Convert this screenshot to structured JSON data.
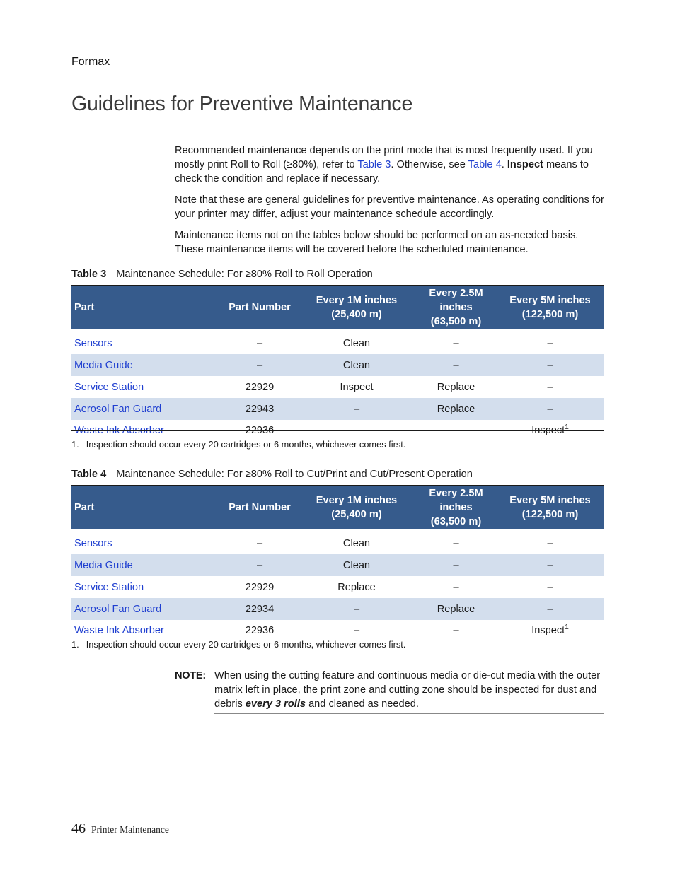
{
  "running_head": "Formax",
  "page_title": "Guidelines for Preventive Maintenance",
  "intro": {
    "p1_a": "Recommended maintenance depends on the print mode that is most frequently used. If you mostly print Roll to Roll (≥80%), refer to ",
    "p1_link1": "Table 3",
    "p1_b": ". Otherwise, see ",
    "p1_link2": "Table 4",
    "p1_c": ". ",
    "p1_bold": "Inspect",
    "p1_d": " means to check the condition and replace if necessary.",
    "p2": "Note that these are general guidelines for preventive maintenance. As operating conditions for your printer may differ, adjust your maintenance schedule accordingly.",
    "p3": "Maintenance items not on the tables below should be performed on an as-needed basis. These maintenance items will be covered before the scheduled maintenance."
  },
  "tables": [
    {
      "label": "Table 3",
      "title": "Maintenance Schedule: For ≥80% Roll to Roll Operation",
      "headers": [
        "Part",
        "Part Number",
        "Every 1M inches",
        "(25,400 m)",
        "Every 2.5M inches",
        "(63,500 m)",
        "Every 5M inches",
        "(122,500 m)"
      ],
      "rows": [
        {
          "part": "Sensors",
          "number": "–",
          "c1": "Clean",
          "c2": "–",
          "c3": "–"
        },
        {
          "part": "Media Guide",
          "number": "–",
          "c1": "Clean",
          "c2": "–",
          "c3": "–"
        },
        {
          "part": "Service Station",
          "number": "22929",
          "c1": "Inspect",
          "c2": "Replace",
          "c3": "–"
        },
        {
          "part": "Aerosol Fan Guard",
          "number": "22943",
          "c1": "–",
          "c2": "Replace",
          "c3": "–"
        },
        {
          "part": "Waste Ink Absorber",
          "number": "22936",
          "c1": "–",
          "c2": "–",
          "c3": "Inspect",
          "c3_sup": "1"
        }
      ],
      "footnote_num": "1.",
      "footnote": "Inspection should occur every 20 cartridges or 6 months, whichever comes first."
    },
    {
      "label": "Table 4",
      "title": "Maintenance Schedule: For ≥80% Roll to Cut/Print and Cut/Present Operation",
      "headers": [
        "Part",
        "Part Number",
        "Every 1M inches",
        "(25,400 m)",
        "Every 2.5M inches",
        "(63,500 m)",
        "Every 5M inches",
        "(122,500 m)"
      ],
      "rows": [
        {
          "part": "Sensors",
          "number": "–",
          "c1": "Clean",
          "c2": "–",
          "c3": "–"
        },
        {
          "part": "Media Guide",
          "number": "–",
          "c1": "Clean",
          "c2": "–",
          "c3": "–"
        },
        {
          "part": "Service Station",
          "number": "22929",
          "c1": "Replace",
          "c2": "–",
          "c3": "–"
        },
        {
          "part": "Aerosol Fan Guard",
          "number": "22934",
          "c1": "–",
          "c2": "Replace",
          "c3": "–"
        },
        {
          "part": "Waste Ink Absorber",
          "number": "22936",
          "c1": "–",
          "c2": "–",
          "c3": "Inspect",
          "c3_sup": "1"
        }
      ],
      "footnote_num": "1.",
      "footnote": "Inspection should occur every 20 cartridges or 6 months, whichever comes first."
    }
  ],
  "note": {
    "label": "NOTE:",
    "text_a": "When using the cutting feature and continuous media or die-cut media with the outer matrix left in place, the print zone and cutting zone should be inspected for dust and debris ",
    "text_bold_italic": "every 3 rolls",
    "text_b": " and cleaned as needed."
  },
  "footer": {
    "page_number": "46",
    "section": "Printer Maintenance"
  },
  "colors": {
    "header_bg": "#365b8c",
    "row_alt_bg": "#d3deed",
    "link": "#1f3fd0"
  }
}
